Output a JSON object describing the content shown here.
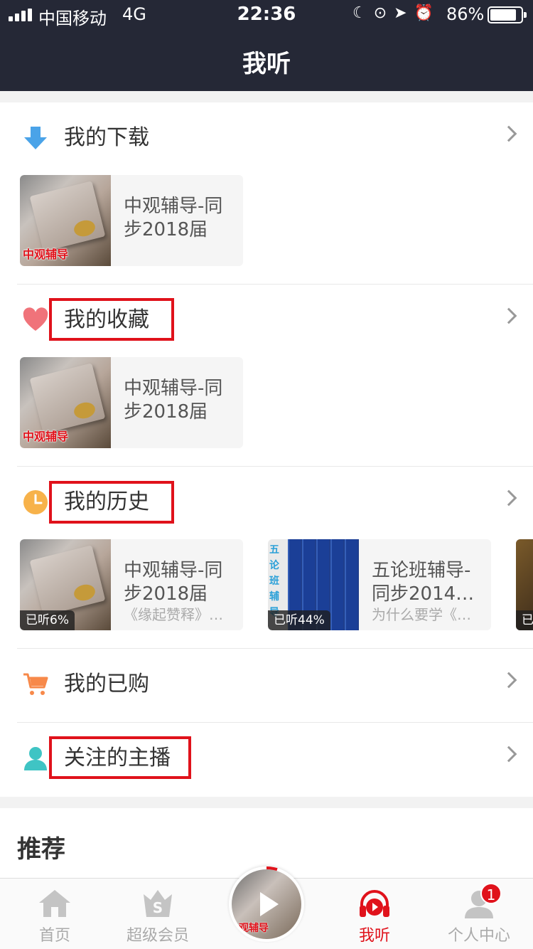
{
  "status_bar": {
    "carrier": "中国移动",
    "network": "4G",
    "time": "22:36",
    "battery": "86%",
    "battery_level": 0.86
  },
  "nav": {
    "title": "我听"
  },
  "sections": {
    "downloads": {
      "title": "我的下载",
      "icon": "download-arrow-icon",
      "items": [
        {
          "title": "中观辅导-同步2018届",
          "thumb_label": "中观辅导"
        }
      ]
    },
    "favorites": {
      "title": "我的收藏",
      "icon": "heart-icon",
      "items": [
        {
          "title": "中观辅导-同步2018届",
          "thumb_label": "中观辅导"
        }
      ]
    },
    "history": {
      "title": "我的历史",
      "icon": "clock-icon",
      "items": [
        {
          "title": "中观辅导-同步2018届",
          "subtitle": "《缘起赞释》…",
          "progress": "已听6%",
          "thumb_label": "中观辅导"
        },
        {
          "title": "五论班辅导-同步2014…",
          "subtitle": "为什么要学《…",
          "progress": "已听44%",
          "thumb_label": "五论班辅导"
        },
        {
          "progress": "已"
        }
      ]
    },
    "purchased": {
      "title": "我的已购",
      "icon": "cart-icon"
    },
    "following": {
      "title": "关注的主播",
      "icon": "person-icon"
    }
  },
  "recommend": {
    "title": "推荐"
  },
  "tabbar": {
    "tabs": [
      {
        "label": "首页",
        "icon": "home-icon"
      },
      {
        "label": "超级会员",
        "icon": "vip-crown-icon"
      },
      {
        "label": "我听",
        "icon": "headphones-icon",
        "active": true
      },
      {
        "label": "个人中心",
        "icon": "profile-icon",
        "badge": "1"
      }
    ],
    "player": {
      "thumb_label": "观辅导",
      "icon": "play-icon"
    }
  },
  "colors": {
    "nav_bg": "#252836",
    "accent_red": "#e0121b",
    "highlight_box": "#e0121b"
  }
}
